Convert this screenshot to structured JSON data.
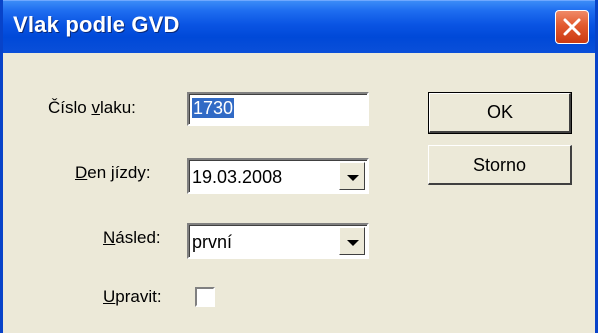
{
  "window": {
    "title": "Vlak podle GVD"
  },
  "form": {
    "train_number": {
      "label_pre": "Číslo ",
      "label_u": "v",
      "label_post": "laku:",
      "value": "1730"
    },
    "travel_day": {
      "label_u": "D",
      "label_post": "en jízdy:",
      "value": "19.03.2008"
    },
    "following": {
      "label_u": "N",
      "label_post": "ásled:",
      "value": "první"
    },
    "edit": {
      "label_u": "U",
      "label_post": "pravit:",
      "checked": false
    }
  },
  "buttons": {
    "ok": "OK",
    "cancel": "Storno"
  }
}
